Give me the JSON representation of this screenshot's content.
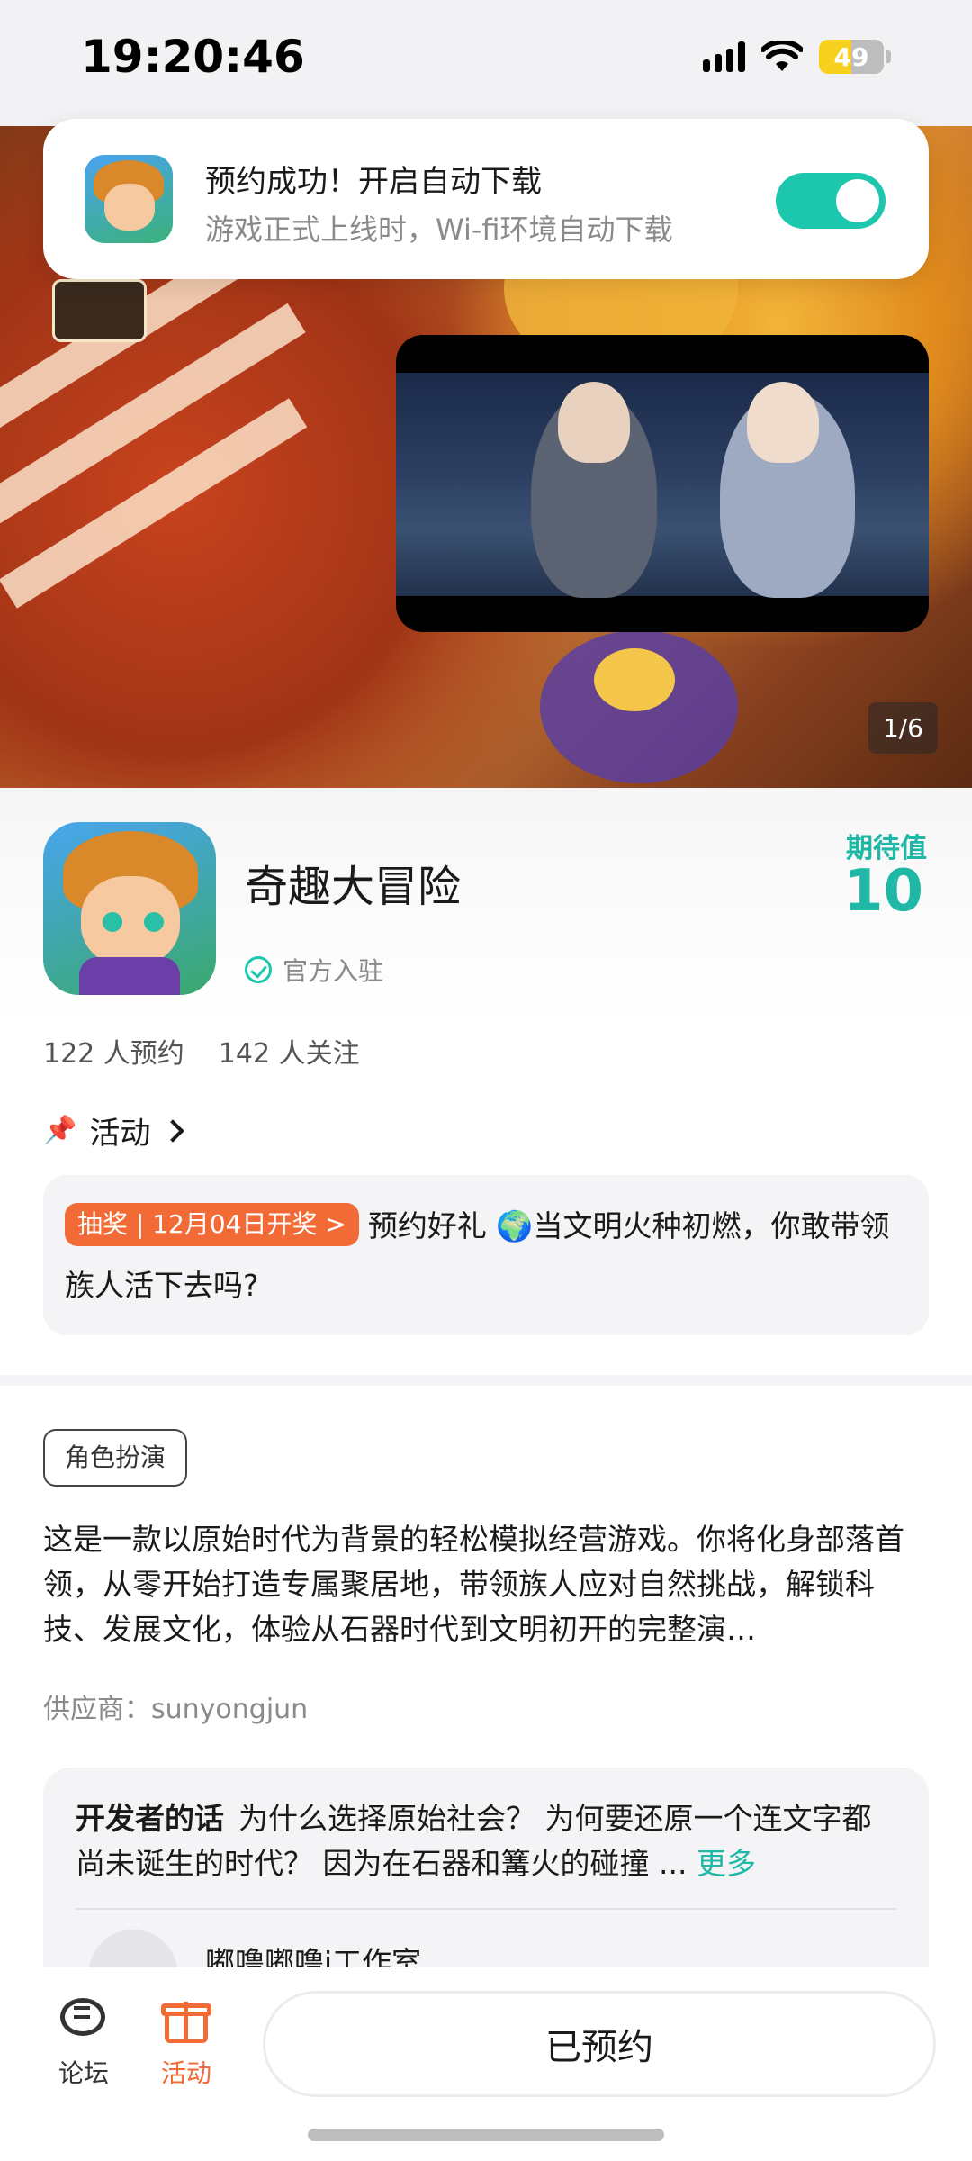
{
  "status_bar": {
    "time": "19:20:46",
    "battery": "49"
  },
  "toast": {
    "title": "预约成功！开启自动下载",
    "subtitle": "游戏正式上线时，Wi-fi环境自动下载",
    "auto_download_enabled": true
  },
  "banner": {
    "page_indicator": "1/6",
    "logo_text": "奇趣大冒险"
  },
  "game": {
    "name": "奇趣大冒险",
    "official_label": "官方入驻",
    "expect_label": "期待值",
    "expect_value": "10",
    "reservations": "122 人预约",
    "followers": "142 人关注"
  },
  "activity": {
    "heading": "活动",
    "tag": "抽奖 | 12月04日开奖 >",
    "text": "预约好礼 🌍当文明火种初燃，你敢带领族人活下去吗?"
  },
  "details": {
    "genre": "角色扮演",
    "description": "这是一款以原始时代为背景的轻松模拟经营游戏。你将化身部落首领，从零开始打造专属聚居地，带领族人应对自然挑战，解锁科技、发展文化，体验从石器时代到文明初开的完整演…",
    "supplier": "供应商：sunyongjun"
  },
  "developer": {
    "heading": "开发者的话",
    "text": "为什么选择原始社会？ 为何要还原一个连文字都尚未诞生的时代？ 因为在石器和篝火的碰撞 ...",
    "more": "更多",
    "studio": "嘟噜嘟噜i工作室"
  },
  "bottom_nav": {
    "forum": "论坛",
    "activity": "活动",
    "reserve_button": "已预约"
  },
  "colors": {
    "accent": "#1fb8a6",
    "orange": "#f26a36",
    "toggle": "#1dc7ae"
  }
}
